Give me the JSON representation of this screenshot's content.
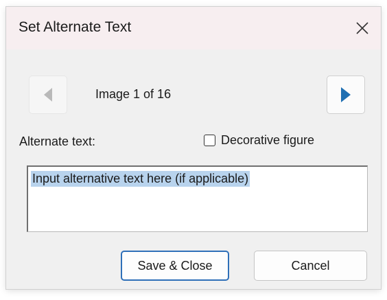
{
  "dialog": {
    "title": "Set Alternate Text",
    "close_icon": "close-icon"
  },
  "navigation": {
    "prev_icon": "triangle-left-icon",
    "next_icon": "triangle-right-icon",
    "counter_text": "Image 1 of 16",
    "prev_enabled": false,
    "next_enabled": true
  },
  "form": {
    "alt_text_label": "Alternate text:",
    "decorative_label": "Decorative figure",
    "decorative_checked": false,
    "alt_text_value": "Input alternative text here (if applicable)"
  },
  "buttons": {
    "save_label": "Save & Close",
    "cancel_label": "Cancel"
  },
  "colors": {
    "titlebar_bg": "#f7eef0",
    "dialog_bg": "#f0f0f0",
    "accent": "#2e6fb8",
    "selection": "#b8d3ed",
    "next_arrow": "#1f6fb2",
    "prev_arrow_disabled": "#b9b9b9"
  }
}
